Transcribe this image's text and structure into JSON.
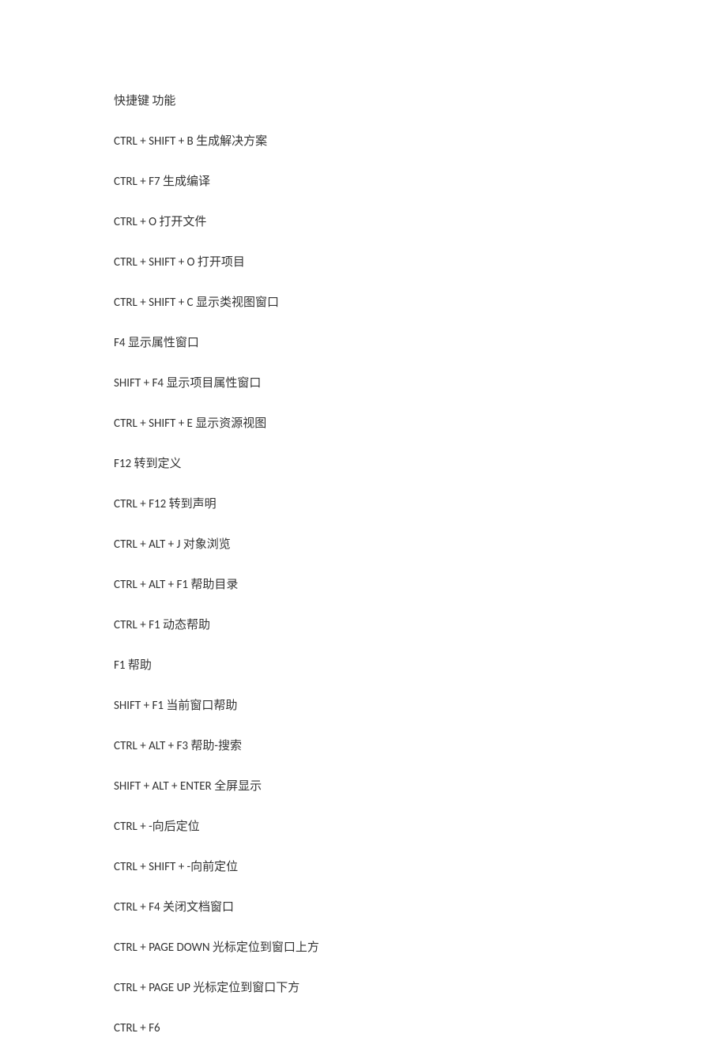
{
  "header": "快捷键  功能",
  "entries": [
    "CTRL + SHIFT + B 生成解决方案",
    "CTRL + F7  生成编译",
    "CTRL + O  打开文件",
    "CTRL + SHIFT + O 打开项目",
    "CTRL + SHIFT + C 显示类视图窗口",
    "F4  显示属性窗口",
    "SHIFT + F4 显示项目属性窗口",
    "CTRL + SHIFT + E 显示资源视图",
    "F12  转到定义",
    "CTRL + F12 转到声明",
    "CTRL + ALT + J 对象浏览",
    "CTRL + ALT + F1 帮助目录",
    "CTRL + F1  动态帮助",
    "F1  帮助",
    "SHIFT + F1 当前窗口帮助",
    "CTRL + ALT + F3 帮助-搜索",
    "SHIFT + ALT + ENTER 全屏显示",
    "CTRL + -向后定位",
    "CTRL + SHIFT + -向前定位",
    "CTRL + F4 关闭文档窗口",
    "CTRL + PAGE DOWN 光标定位到窗口上方",
    "CTRL + PAGE UP 光标定位到窗口下方",
    "CTRL + F6"
  ]
}
